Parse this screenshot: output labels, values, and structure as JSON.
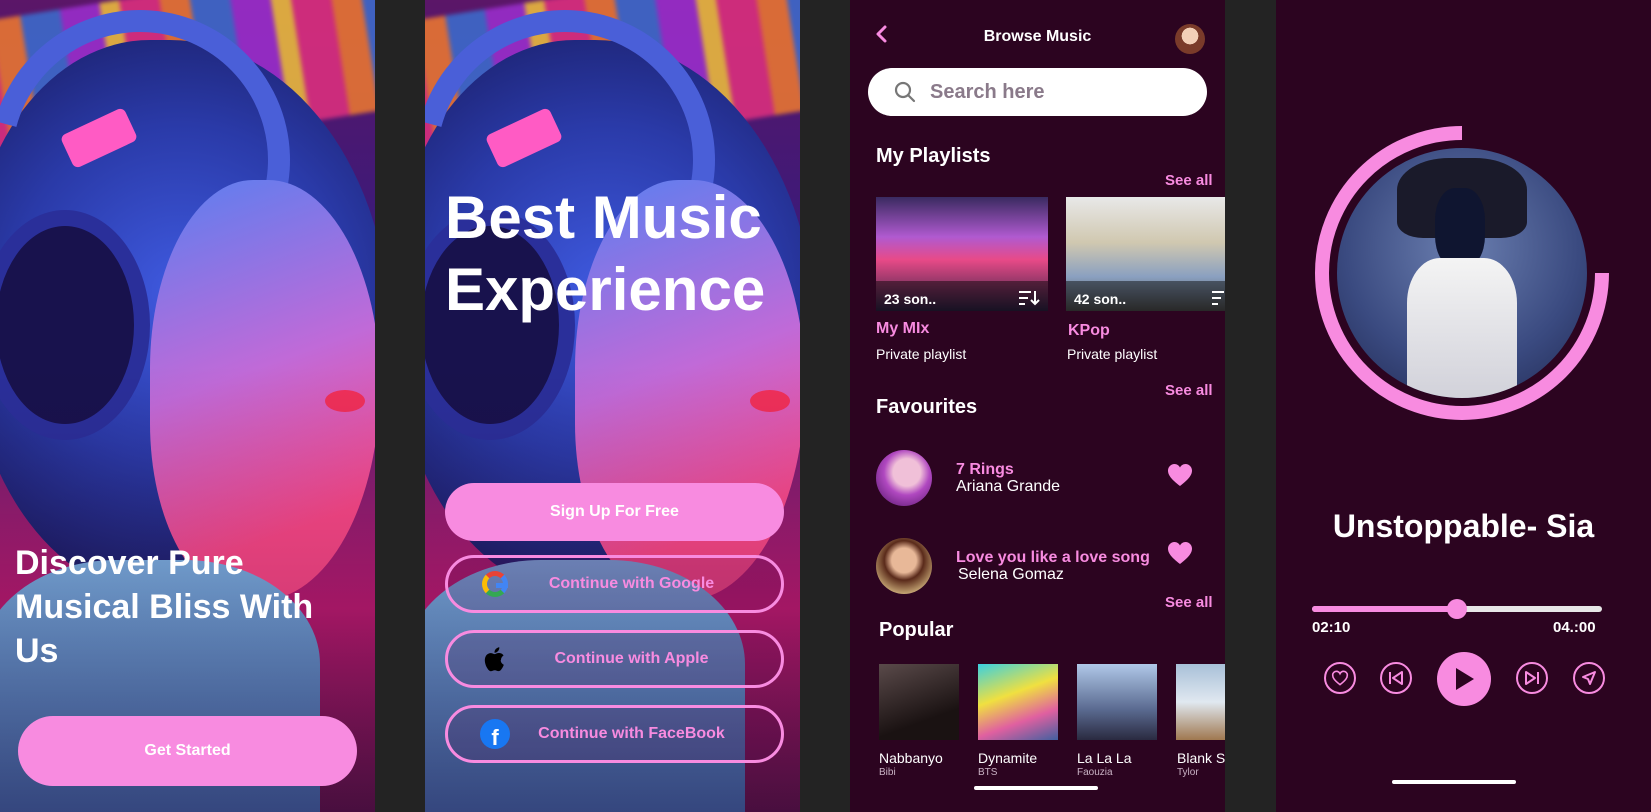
{
  "colors": {
    "accent": "#f88be0",
    "bg_dark": "#2c0420",
    "white": "#ffffff"
  },
  "screen1": {
    "headline": "Discover Pure Musical Bliss With Us",
    "cta": "Get Started"
  },
  "screen2": {
    "headline": "Best Music Experience",
    "signup": "Sign Up For Free",
    "google": "Continue with Google",
    "apple": "Continue with Apple",
    "facebook": "Continue with FaceBook"
  },
  "screen3": {
    "title": "Browse Music",
    "search_placeholder": "Search here",
    "playlists_heading": "My Playlists",
    "see_all": "See all",
    "playlists": [
      {
        "count": "23 son..",
        "name": "My MIx",
        "sub": "Private playlist"
      },
      {
        "count": "42 son..",
        "name": "KPop",
        "sub": "Private playlist"
      }
    ],
    "favourites_heading": "Favourites",
    "favourites": [
      {
        "song": "7 Rings",
        "artist": "Ariana Grande"
      },
      {
        "song": "Love you like a love song",
        "artist": "Selena Gomaz"
      }
    ],
    "popular_heading": "Popular",
    "popular": [
      {
        "name": "Nabbanyo",
        "artist": "Bibi"
      },
      {
        "name": "Dynamite",
        "artist": "BTS"
      },
      {
        "name": "La La La",
        "artist": "Faouzia"
      },
      {
        "name": "Blank S",
        "artist": "Tylor"
      }
    ]
  },
  "screen4": {
    "title": "Unstoppable- Sia",
    "elapsed": "02:10",
    "duration": "04.:00",
    "progress_fraction": 0.5
  }
}
